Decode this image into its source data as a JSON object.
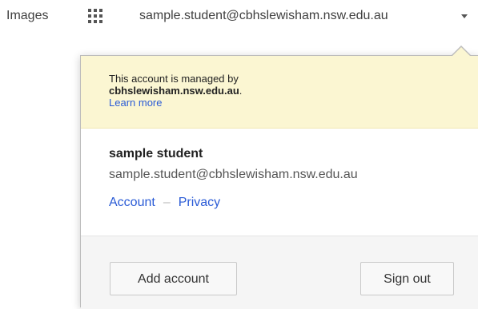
{
  "topbar": {
    "images_label": "Images",
    "apps_icon": "apps-grid-icon",
    "account_email": "sample.student@cbhslewisham.nsw.edu.au",
    "caret_icon": "caret-down-icon"
  },
  "popup": {
    "notice": {
      "text": "This account is managed by",
      "domain": "cbhslewisham.nsw.edu.au",
      "domain_suffix": ".",
      "learn_more": "Learn more",
      "background": "#fbf6d2"
    },
    "user": {
      "name": "sample student",
      "email": "sample.student@cbhslewisham.nsw.edu.au"
    },
    "links": {
      "account": "Account",
      "separator": "–",
      "privacy": "Privacy"
    },
    "buttons": {
      "add_account": "Add account",
      "sign_out": "Sign out"
    }
  },
  "colors": {
    "link": "#2a5bd6",
    "notice_bg": "#fbf6d2",
    "footer_bg": "#f5f5f5"
  }
}
